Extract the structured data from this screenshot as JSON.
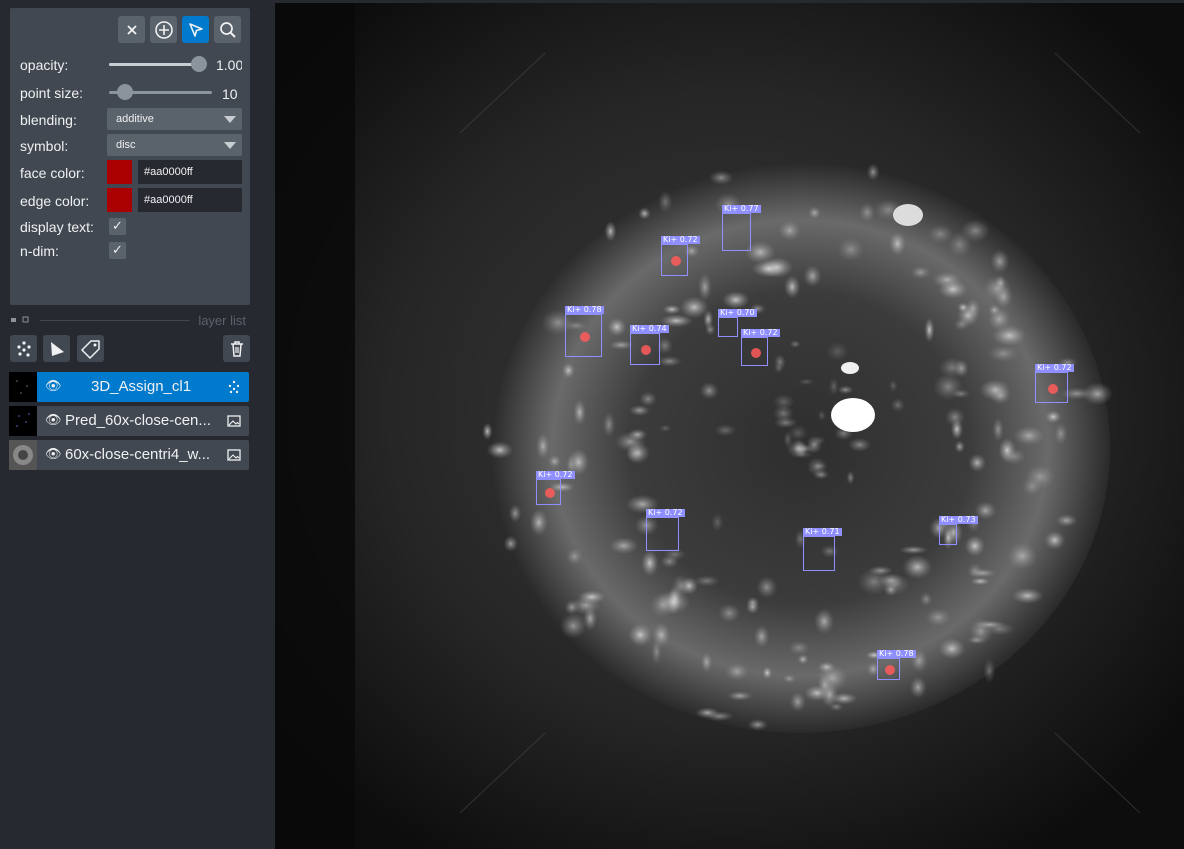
{
  "toolbar": {
    "delete_icon": "close-icon",
    "add_icon": "add-points-icon",
    "select_icon": "select-arrow-icon",
    "zoom_icon": "zoom-magnifier-icon",
    "active_tool": "select"
  },
  "controls": {
    "opacity": {
      "label": "opacity:",
      "value": "1.00",
      "fraction": 1.0
    },
    "point_size": {
      "label": "point size:",
      "value": "10",
      "fraction": 0.1
    },
    "blending": {
      "label": "blending:",
      "value": "additive"
    },
    "symbol": {
      "label": "symbol:",
      "value": "disc"
    },
    "face_color": {
      "label": "face color:",
      "hex": "#aa0000ff",
      "color": "#aa0000"
    },
    "edge_color": {
      "label": "edge color:",
      "hex": "#aa0000ff",
      "color": "#aa0000"
    },
    "display_text": {
      "label": "display text:",
      "checked": true
    },
    "n_dim": {
      "label": "n-dim:",
      "checked": true
    }
  },
  "layer_list": {
    "title": "layer list",
    "layers": [
      {
        "name": "3D_Assign_cl1",
        "type": "points",
        "selected": true,
        "visible": true
      },
      {
        "name": "Pred_60x-close-cen...",
        "type": "image",
        "selected": false,
        "visible": true
      },
      {
        "name": "60x-close-centri4_w...",
        "type": "image",
        "selected": false,
        "visible": true
      }
    ]
  },
  "colors": {
    "accent": "#007acc",
    "panel_bg": "#262930",
    "control_bg": "#414851",
    "detection_box": "#8f8fff",
    "point_color": "#aa0000"
  },
  "detections": [
    {
      "label": "Ki+ 0.77"
    },
    {
      "label": "Ki+ 0.72"
    },
    {
      "label": "Ki+ 0.78"
    },
    {
      "label": "Ki+ 0.74"
    },
    {
      "label": "Ki+ 0.70"
    },
    {
      "label": "Ki+ 0.72"
    },
    {
      "label": "Ki+ 0.72"
    },
    {
      "label": "Ki+ 0.72"
    },
    {
      "label": "Ki+ 0.72"
    },
    {
      "label": "Ki+ 0.71"
    },
    {
      "label": "Ki+ 0.73"
    },
    {
      "label": "Ki+ 0.78"
    }
  ]
}
